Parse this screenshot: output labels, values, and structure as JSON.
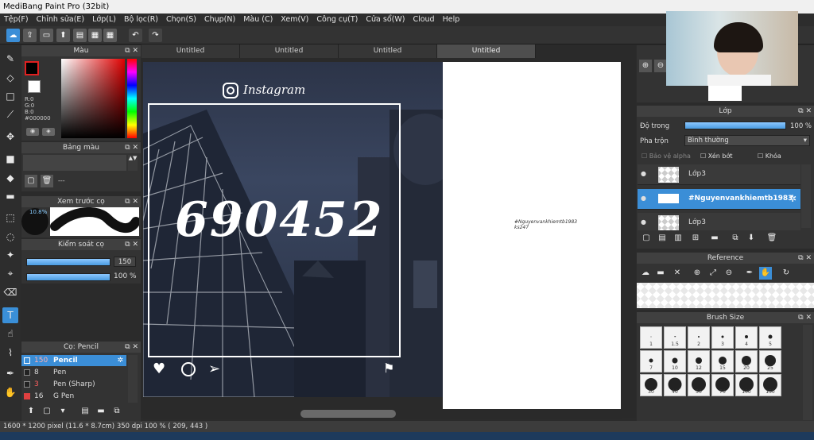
{
  "app_title": "MediBang Paint Pro (32bit)",
  "window_controls": [
    "–",
    "□",
    "✕"
  ],
  "menu": [
    "Tệp(F)",
    "Chỉnh sửa(E)",
    "Lớp(L)",
    "Bộ lọc(R)",
    "Chọn(S)",
    "Chụp(N)",
    "Màu (C)",
    "Xem(V)",
    "Công cụ(T)",
    "Cửa sổ(W)",
    "Cloud",
    "Help"
  ],
  "tabs": [
    "Untitled",
    "Untitled",
    "Untitled",
    "Untitled"
  ],
  "color_panel": {
    "title": "Màu",
    "r": "R:0",
    "g": "G:0",
    "b": "B:0",
    "hex": "#000000",
    "primary": "#000000",
    "secondary": "#ffffff"
  },
  "palette_panel": {
    "title": "Bảng màu",
    "dash": "---"
  },
  "preview_panel": {
    "title": "Xem trước cọ",
    "size": "10.8%"
  },
  "control_panel": {
    "title": "Kiểm soát cọ",
    "size_value": "150",
    "opacity_value": "100 %"
  },
  "brush_panel": {
    "title": "Cọ: Pencil",
    "items": [
      {
        "size": "150",
        "name": "Pencil",
        "color": "#3b8ed7",
        "selected": true
      },
      {
        "size": "8",
        "name": "Pen",
        "color": "#ffffff",
        "selected": false
      },
      {
        "size": "3",
        "name": "Pen (Sharp)",
        "color": "#e04040",
        "selected": false
      },
      {
        "size": "16",
        "name": "G Pen",
        "color": "#e04040",
        "selected": false
      }
    ]
  },
  "canvas": {
    "instagram_label": "Instagram",
    "big_number": "690452",
    "small_text_line1": "#Nguyenvankhiemtb1983",
    "small_text_line2": "ks247"
  },
  "layer_panel": {
    "title": "Lớp",
    "opacity_label": "Độ trong",
    "opacity_value": "100 %",
    "blend_label": "Pha trộn",
    "blend_value": "Bình thường",
    "protect_alpha": "Bảo vệ alpha",
    "clipping": "Xén bớt",
    "lock": "Khóa",
    "layers": [
      {
        "name": "Lớp3",
        "selected": false
      },
      {
        "name": "#Nguyenvankhiemtb1983",
        "selected": true
      },
      {
        "name": "Lớp3",
        "selected": false
      }
    ]
  },
  "reference_panel": {
    "title": "Reference"
  },
  "brush_size_panel": {
    "title": "Brush Size",
    "sizes": [
      "1",
      "1.5",
      "2",
      "3",
      "4",
      "5",
      "7",
      "10",
      "12",
      "15",
      "20",
      "25",
      "30",
      "40",
      "50",
      "70",
      "100",
      "150"
    ]
  },
  "status": {
    "text": "1600 * 1200 pixel  (11.6 * 8.7cm)  350 dpi  100 %  ( 209, 443 )"
  }
}
